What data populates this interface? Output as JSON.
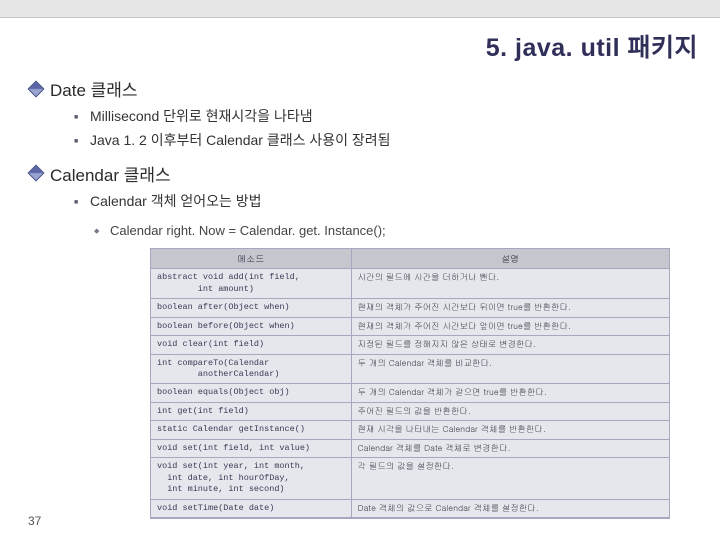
{
  "title": "5. java. util 패키지",
  "pageNumber": "37",
  "sections": [
    {
      "heading": "Date 클래스",
      "bullets": [
        "Millisecond 단위로 현재시각을 나타냄",
        "Java 1. 2 이후부터 Calendar 클래스 사용이 장려됨"
      ]
    },
    {
      "heading": "Calendar 클래스",
      "bullets": [
        "Calendar 객체 얻어오는 방법"
      ],
      "subbullets": [
        "Calendar right. Now = Calendar. get. Instance();"
      ]
    }
  ],
  "table": {
    "headers": [
      "메소드",
      "설명"
    ],
    "rows": [
      [
        "abstract void add(int field,\n        int amount)",
        "시간의 필드에 시간을 더하거나 뺀다."
      ],
      [
        "boolean after(Object when)",
        "현재의 객체가 주어진 시간보다 뒤이면 true를 반환한다."
      ],
      [
        "boolean before(Object when)",
        "현재의 객체가 주어진 시간보다 앞이면 true를 반환한다."
      ],
      [
        "void clear(int field)",
        "지정된 필드를 정해지지 않은 상태로 변경한다."
      ],
      [
        "int compareTo(Calendar\n        anotherCalendar)",
        "두 개의 Calendar 객체를 비교한다."
      ],
      [
        "boolean equals(Object obj)",
        "두 개의 Calendar 객체가 같으면 true를 반환한다."
      ],
      [
        "int get(int field)",
        "주어진 필드의 값을 반환한다."
      ],
      [
        "static Calendar getInstance()",
        "현재 시각을 나타내는 Calendar 객체를 반환한다."
      ],
      [
        "void set(int field, int value)",
        "Calendar 객체를 Date 객체로 변경한다."
      ],
      [
        "void set(int year, int month,\n  int date, int hourOfDay,\n  int minute, int second)",
        "각 필드의 값을 설정한다."
      ],
      [
        "void setTime(Date date)",
        "Date 객체의 값으로 Calendar 객체를 설정한다."
      ]
    ]
  }
}
